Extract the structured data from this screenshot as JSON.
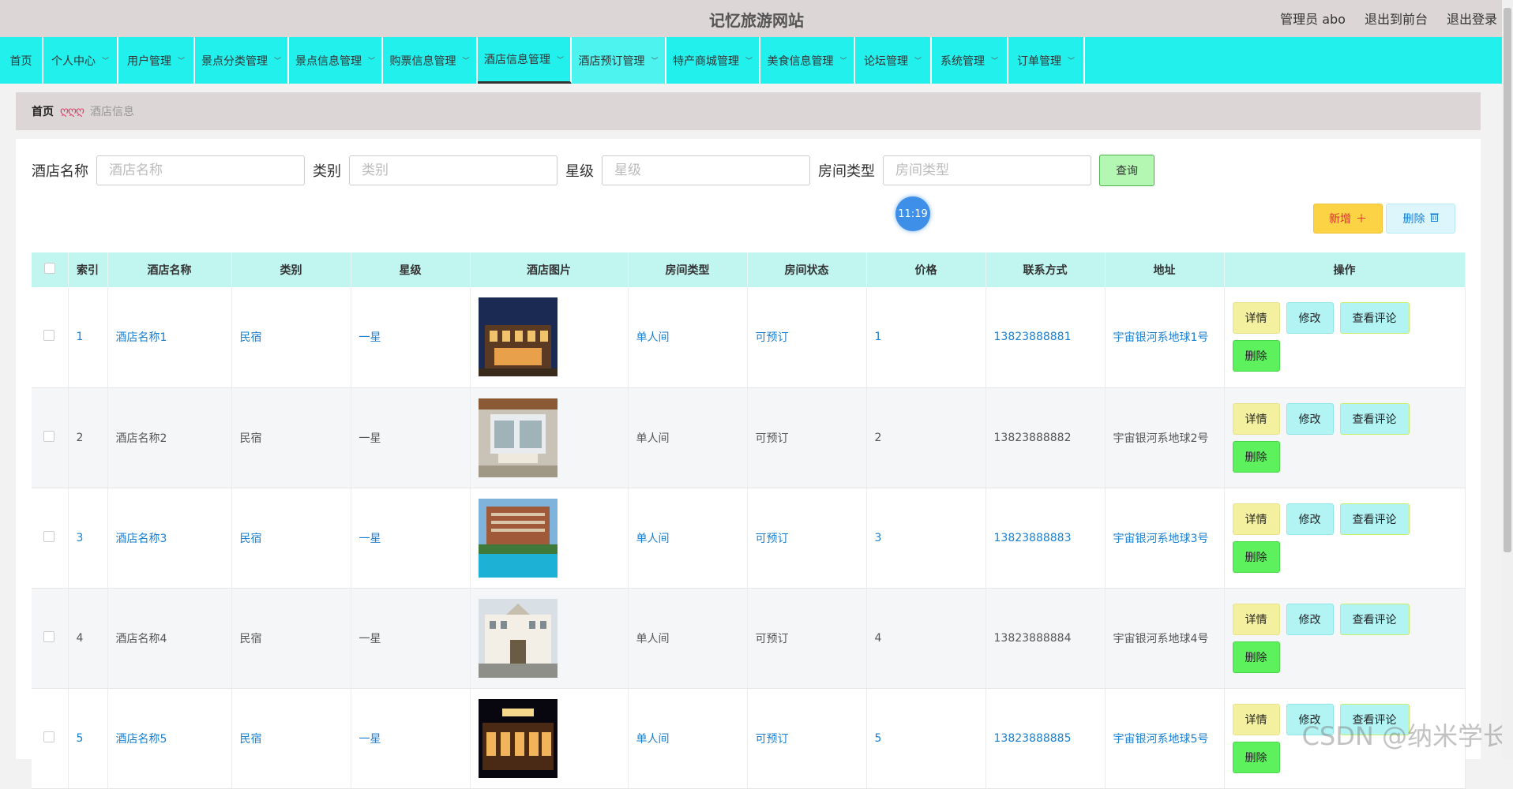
{
  "header": {
    "site_title": "记忆旅游网站",
    "admin_label": "管理员 abo",
    "back_to_front": "退出到前台",
    "logout": "退出登录"
  },
  "nav": {
    "items": [
      {
        "label": "首页"
      },
      {
        "label": "个人中心"
      },
      {
        "label": "用户管理"
      },
      {
        "label": "景点分类管理"
      },
      {
        "label": "景点信息管理"
      },
      {
        "label": "购票信息管理"
      },
      {
        "label": "酒店信息管理"
      },
      {
        "label": "酒店预订管理"
      },
      {
        "label": "特产商城管理"
      },
      {
        "label": "美食信息管理"
      },
      {
        "label": "论坛管理"
      },
      {
        "label": "系统管理"
      },
      {
        "label": "订单管理"
      }
    ]
  },
  "breadcrumb": {
    "home": "首页",
    "separator": "ღღღ",
    "current": "酒店信息"
  },
  "search": {
    "name_label": "酒店名称",
    "name_placeholder": "酒店名称",
    "category_label": "类别",
    "category_placeholder": "类别",
    "star_label": "星级",
    "star_placeholder": "星级",
    "room_label": "房间类型",
    "room_placeholder": "房间类型",
    "query_button": "查询"
  },
  "clock": "11:19",
  "actions": {
    "add": "新增",
    "delete": "删除"
  },
  "table": {
    "headers": [
      "索引",
      "酒店名称",
      "类别",
      "星级",
      "酒店图片",
      "房间类型",
      "房间状态",
      "价格",
      "联系方式",
      "地址",
      "操作"
    ],
    "rows": [
      {
        "index": "1",
        "name": "酒店名称1",
        "category": "民宿",
        "star": "一星",
        "room_type": "单人间",
        "room_status": "可预订",
        "price": "1",
        "contact": "13823888881",
        "address": "宇宙银河系地球1号"
      },
      {
        "index": "2",
        "name": "酒店名称2",
        "category": "民宿",
        "star": "一星",
        "room_type": "单人间",
        "room_status": "可预订",
        "price": "2",
        "contact": "13823888882",
        "address": "宇宙银河系地球2号"
      },
      {
        "index": "3",
        "name": "酒店名称3",
        "category": "民宿",
        "star": "一星",
        "room_type": "单人间",
        "room_status": "可预订",
        "price": "3",
        "contact": "13823888883",
        "address": "宇宙银河系地球3号"
      },
      {
        "index": "4",
        "name": "酒店名称4",
        "category": "民宿",
        "star": "一星",
        "room_type": "单人间",
        "room_status": "可预订",
        "price": "4",
        "contact": "13823888884",
        "address": "宇宙银河系地球4号"
      },
      {
        "index": "5",
        "name": "酒店名称5",
        "category": "民宿",
        "star": "一星",
        "room_type": "单人间",
        "room_status": "可预订",
        "price": "5",
        "contact": "13823888885",
        "address": "宇宙银河系地球5号"
      }
    ],
    "ops": {
      "detail": "详情",
      "edit": "修改",
      "review": "查看评论",
      "delete": "删除"
    }
  },
  "watermark": "CSDN @纳米学长",
  "colors": {
    "nav_bg": "#22f0ec",
    "header_bg": "#dcd6d6",
    "table_header_bg": "#c0f5f0",
    "link_blue": "#1a7fd0"
  }
}
